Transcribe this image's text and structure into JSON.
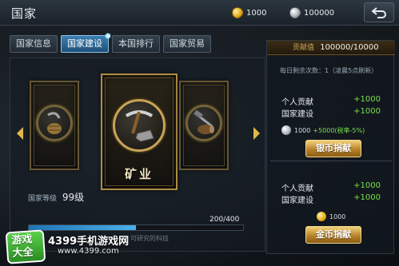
{
  "header": {
    "title": "国家",
    "gold_amount": "1000",
    "silver_amount": "100000"
  },
  "tabs": [
    {
      "label": "国家信息",
      "active": false
    },
    {
      "label": "国家建设",
      "active": true
    },
    {
      "label": "本国排行",
      "active": false
    },
    {
      "label": "国家贸易",
      "active": false
    }
  ],
  "building": {
    "selected_label": "矿业",
    "level_label": "国家等级",
    "level_value": "99级",
    "progress_text": "200/400",
    "progress_fraction": 0.5,
    "progress_hint": "可研究的科技"
  },
  "contribution": {
    "label": "贡献值",
    "value": "100000/10000",
    "daily_text": "每日剩余次数：1（凌晨5点刷新）"
  },
  "silver_donation": {
    "personal_label": "个人贡献",
    "personal_amount": "+1000",
    "national_label": "国家建设",
    "national_amount": "+1000",
    "cost": "1000",
    "bonus": "+5000(税率-5%)",
    "button": "银币捐献"
  },
  "gold_donation": {
    "personal_label": "个人贡献",
    "personal_amount": "+1000",
    "national_label": "国家建设",
    "national_amount": "+1000",
    "cost": "1000",
    "button": "金币捐献"
  },
  "watermark": {
    "logo": "游戏大全",
    "site": "4399手机游戏网",
    "url": "www.4399.com"
  },
  "colors": {
    "gold_accent": "#e0b84a",
    "green_value": "#78e04a",
    "tab_active": "#3c7fb0"
  }
}
